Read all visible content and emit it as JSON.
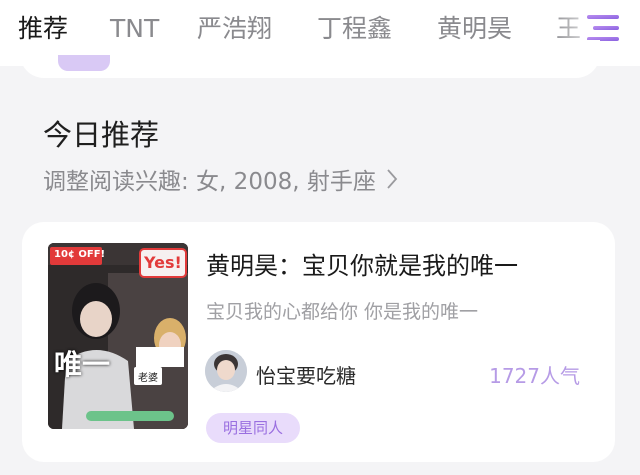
{
  "tabs": {
    "items": [
      {
        "label": "推荐",
        "active": true
      },
      {
        "label": "TNT",
        "active": false
      },
      {
        "label": "严浩翔",
        "active": false
      },
      {
        "label": "丁程鑫",
        "active": false
      },
      {
        "label": "黄明昊",
        "active": false
      },
      {
        "label": "王",
        "active": false
      }
    ],
    "menu_icon": "menu-lines-icon",
    "accent": "#9d6de0"
  },
  "section": {
    "title": "今日推荐",
    "interest": "调整阅读兴趣: 女, 2008, 射手座",
    "chevron_icon": "chevron-right-icon"
  },
  "article": {
    "cover": {
      "badge_left": "10¢ OFF!",
      "badge_right": "Yes!",
      "big_text": "唯一",
      "sticker_small": "老婆"
    },
    "title": "黄明昊：宝贝你就是我的唯一",
    "summary": "宝贝我的心都给你 你是我的唯一",
    "author": "怡宝要吃糖",
    "popularity": "1727人气",
    "tag": "明星同人",
    "popularity_color": "#b69be6"
  }
}
